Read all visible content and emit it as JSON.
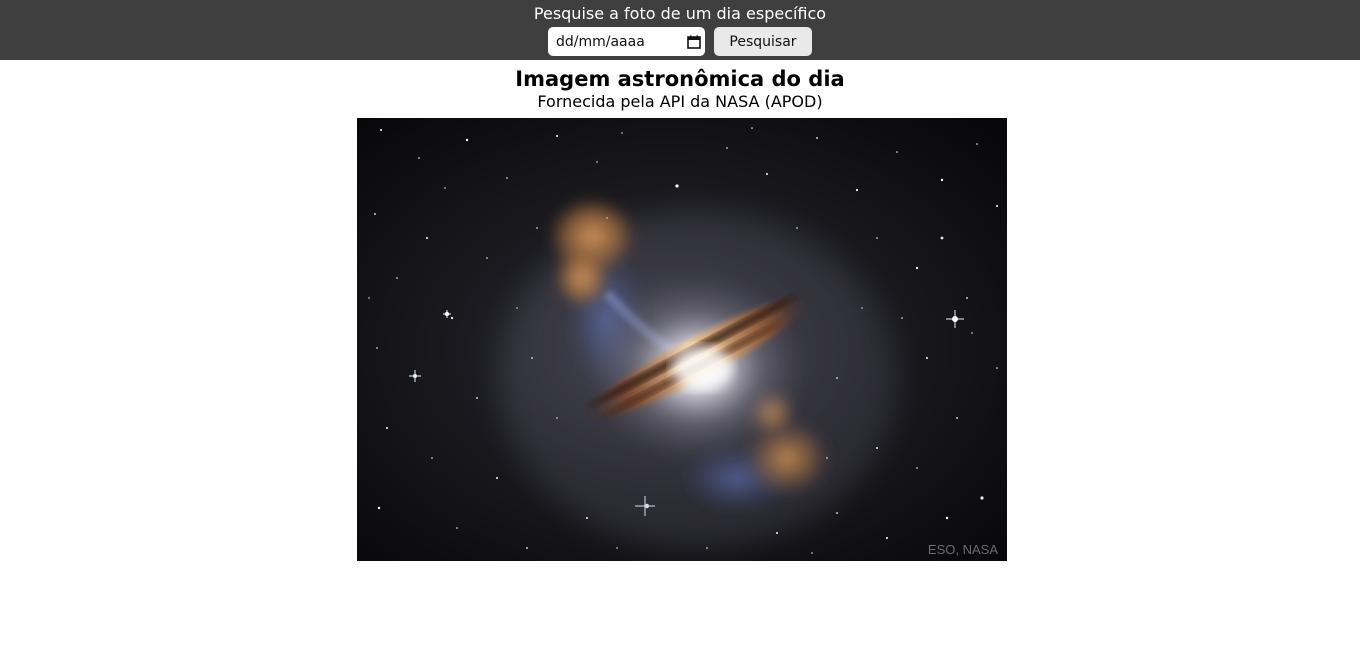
{
  "header": {
    "title": "Pesquise a foto de um dia específico",
    "date_input": {
      "placeholder": "dd/mm/aaaa",
      "icon": "calendar-icon"
    },
    "search_label": "Pesquisar"
  },
  "main": {
    "title": "Imagem astronômica do dia",
    "subtitle": "Fornecida pela API da NASA (APOD)",
    "image": {
      "subject": "galaxy with dust lane and jets",
      "credit": "ESO, NASA"
    }
  },
  "colors": {
    "topbar": "#3f3f3f",
    "button": "#e9e9e9",
    "space": "#0b0b0e"
  }
}
